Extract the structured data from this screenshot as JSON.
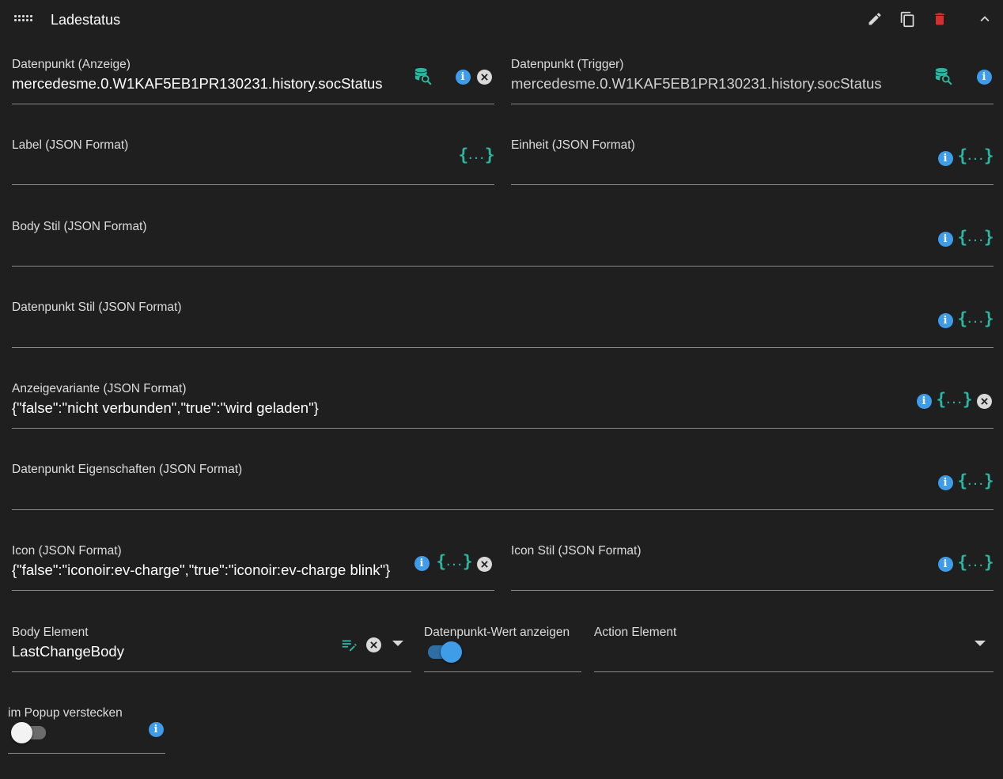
{
  "header": {
    "title": "Ladestatus"
  },
  "fields": {
    "dp_display": {
      "label": "Datenpunkt (Anzeige)",
      "value": "mercedesme.0.W1KAF5EB1PR130231.history.socStatus"
    },
    "dp_trigger": {
      "label": "Datenpunkt (Trigger)",
      "value": "mercedesme.0.W1KAF5EB1PR130231.history.socStatus"
    },
    "label_json": {
      "label": "Label (JSON Format)"
    },
    "unit_json": {
      "label": "Einheit (JSON Format)"
    },
    "body_style": {
      "label": "Body Stil (JSON Format)"
    },
    "dp_style": {
      "label": "Datenpunkt Stil (JSON Format)"
    },
    "display_variant": {
      "label": "Anzeigevariante (JSON Format)",
      "value": "{\"false\":\"nicht verbunden\",\"true\":\"wird geladen\"}"
    },
    "dp_props": {
      "label": "Datenpunkt Eigenschaften (JSON Format)"
    },
    "icon_json": {
      "label": "Icon (JSON Format)",
      "value": "{\"false\":\"iconoir:ev-charge\",\"true\":\"iconoir:ev-charge blink\"}"
    },
    "icon_style": {
      "label": "Icon Stil (JSON Format)"
    },
    "body_element": {
      "label": "Body Element",
      "value": "LastChangeBody"
    },
    "show_dp_value": {
      "label": "Datenpunkt-Wert anzeigen",
      "checked": true
    },
    "action_element": {
      "label": "Action Element",
      "value": ""
    },
    "hide_in_popup": {
      "label": "im Popup verstecken",
      "checked": false
    }
  },
  "json_button": {
    "open": "{",
    "dots": "...",
    "close": "}"
  },
  "colors": {
    "background": "#1f1f1f",
    "info": "#3f9ce8",
    "json_accent": "#2cb5a0",
    "delete": "#d32f2f",
    "toggle_on": "#3f9ce8"
  },
  "icons": {
    "drag": "drag-handle-icon",
    "edit": "pencil-icon",
    "copy": "copy-icon",
    "delete": "trash-icon",
    "collapse": "chevron-up-icon",
    "select_dp": "database-search-icon",
    "info": "info-icon",
    "clear": "clear-icon",
    "json": "json-braces-icon",
    "edit_body": "edit-list-icon",
    "dropdown": "dropdown-arrow-icon"
  }
}
